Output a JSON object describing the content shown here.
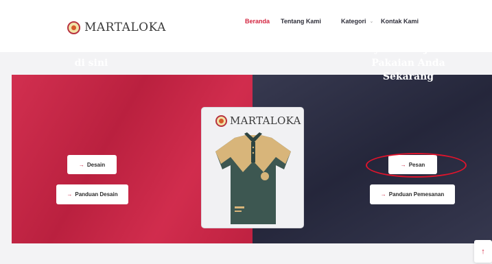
{
  "brand": {
    "name": "MARTALOKA"
  },
  "nav": {
    "items": [
      {
        "label": "Beranda",
        "active": true
      },
      {
        "label": "Tentang Kami",
        "active": false
      },
      {
        "label": "Kategori",
        "active": false,
        "has_dropdown": true
      },
      {
        "label": "Kontak Kami",
        "active": false
      }
    ]
  },
  "hero": {
    "left": {
      "title": "Kreasikan Kaos Anda di sini",
      "primary_button": "Desain",
      "secondary_button": "Panduan Desain"
    },
    "right": {
      "title": "Ayo Pesan jenis Pakaian Anda Sekarang",
      "primary_button": "Pesan",
      "secondary_button": "Panduan Pemesanan"
    },
    "card": {
      "brand": "MARTALOKA"
    }
  },
  "icons": {
    "button_arrow": "→",
    "dropdown": "⌄",
    "scroll_top": "↑"
  },
  "colors": {
    "accent_red": "#cf2446",
    "nav_active": "#d3243f",
    "dark_panel": "#2b2d45",
    "annotation": "#e0142c",
    "shirt_main": "#3d5751",
    "shirt_accent": "#d8b57a"
  }
}
